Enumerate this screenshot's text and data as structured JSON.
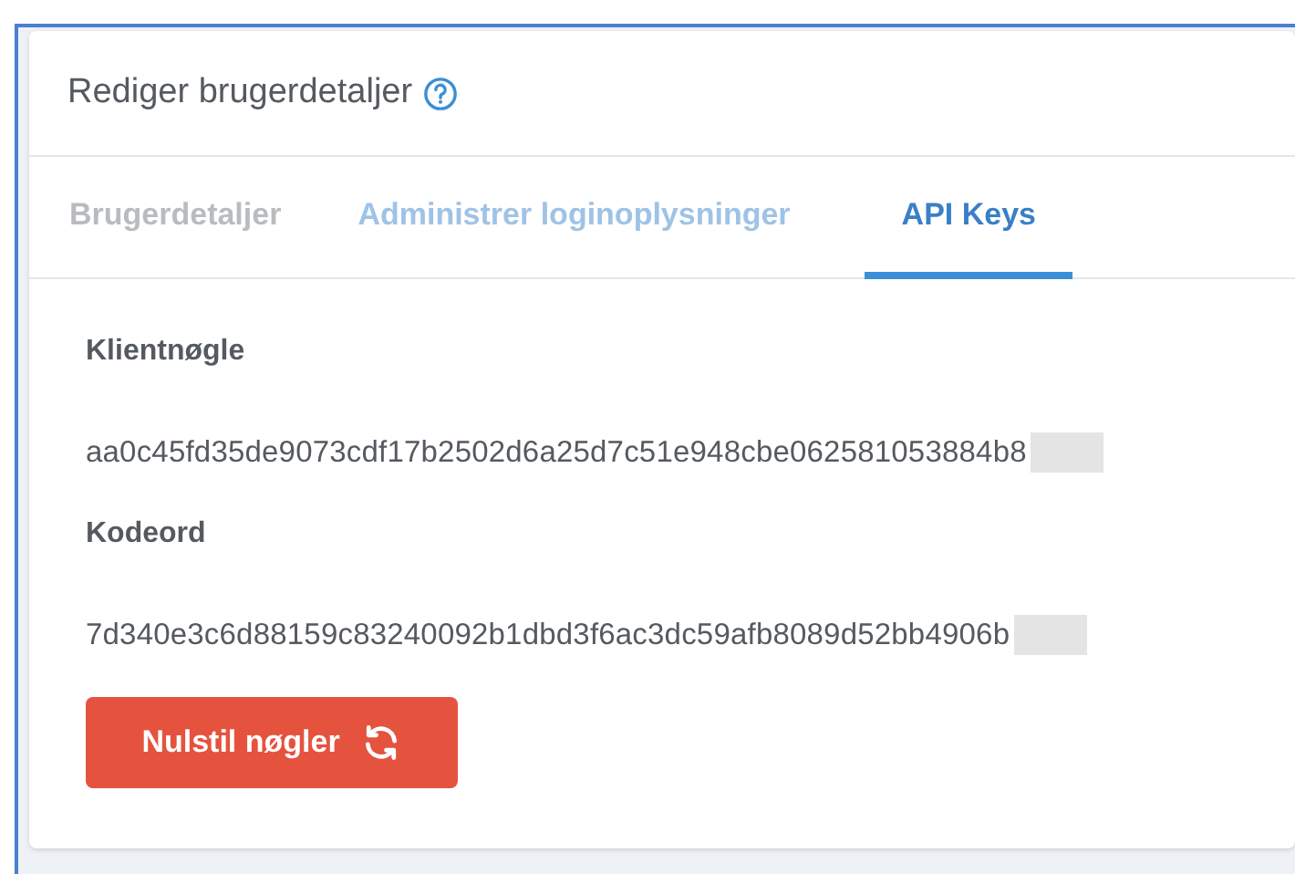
{
  "panel": {
    "title": "Rediger brugerdetaljer"
  },
  "tabs": [
    {
      "label": "Brugerdetaljer",
      "selected": false,
      "disabled": true
    },
    {
      "label": "Administrer loginoplysninger",
      "selected": false,
      "disabled": false
    },
    {
      "label": "API Keys",
      "selected": true,
      "disabled": false
    }
  ],
  "fields": [
    {
      "label": "Klientnøgle",
      "value": "aa0c45fd35de9073cdf17b2502d6a25d7c51e948cbe062581053884b8"
    },
    {
      "label": "Kodeord",
      "value": "7d340e3c6d88159c83240092b1dbd3f6ac3dc59afb8089d52bb4906b"
    }
  ],
  "reset_button": {
    "label": "Nulstil nøgler"
  }
}
